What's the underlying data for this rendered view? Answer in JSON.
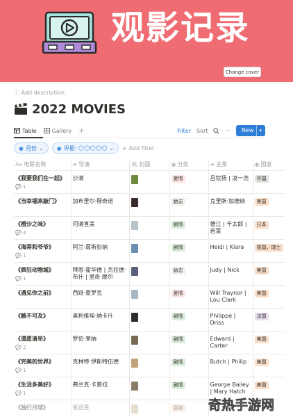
{
  "cover": {
    "title": "观影记录",
    "change_cover_label": "Change cover",
    "background_color": "#ee6c72",
    "logo_icon": "tv-play-icon"
  },
  "page": {
    "add_description": "Add description",
    "title_icon": "clapper-board-icon",
    "title": "2022 MOVIES"
  },
  "view_bar": {
    "tabs": [
      {
        "label": "Table",
        "icon": "table-icon",
        "active": true
      },
      {
        "label": "Gallery",
        "icon": "gallery-icon",
        "active": false
      }
    ],
    "add_view": "+",
    "filter_label": "Filter",
    "sort_label": "Sort",
    "new_label": "New",
    "accent_color": "#2e7dd7"
  },
  "filters": {
    "month_pill": "月份",
    "rating_pill": "评星: 🌕🌕🌕🌕🌕",
    "add_filter": "+ Add filter"
  },
  "table": {
    "columns": [
      {
        "label": "电影名称",
        "icon": "Aa"
      },
      {
        "label": "导演",
        "icon": "text-icon"
      },
      {
        "label": "封面",
        "icon": "paperclip-icon"
      },
      {
        "label": "分类",
        "icon": "select-icon"
      },
      {
        "label": "主角",
        "icon": "text-icon"
      },
      {
        "label": "国家",
        "icon": "select-icon"
      }
    ],
    "rows": [
      {
        "title": "《我要我们在一起》",
        "comments": "1",
        "director": "沙漠",
        "category": "爱情",
        "cast": "吕钦扬 | 凌一尧",
        "country": "中国",
        "poster": "#6f8a3d"
      },
      {
        "title": "《当幸福来敲门》",
        "comments": "",
        "director": "加布里尔·穆奇诺",
        "category": "励志",
        "cast": "克里斯·加德纳",
        "country": "美国",
        "poster": "#3a2a2a"
      },
      {
        "title": "《橙沙之味》",
        "comments": "4",
        "director": "河濑直美",
        "category": "剧情",
        "cast": "德江 | 千太郎 | 若菜",
        "country": "日本",
        "poster": "#b7c4c9"
      },
      {
        "title": "《海蒂和爷爷》",
        "comments": "1",
        "director": "阿兰·葛斯彭纳",
        "category": "剧情",
        "cast": "Heidi | Klara",
        "country": "德国，瑞士",
        "poster": "#6b8fb0"
      },
      {
        "title": "《疯狂动物城》",
        "comments": "1",
        "director": "拜恩·霍华德 | 杰拉德·布什 | 里奇·摩尔",
        "category": "励志",
        "cast": "Judy | Nick",
        "country": "美国",
        "poster": "#5a5f7a"
      },
      {
        "title": "《遇见你之前》",
        "comments": "",
        "director": "西娅·夏罗克",
        "category": "爱情",
        "cast": "Will Traynor | Lou Clark",
        "country": "美国",
        "poster": "#a7b8c4"
      },
      {
        "title": "《触不可及》",
        "comments": "",
        "director": "奥利维埃·纳卡什",
        "category": "剧情",
        "cast": "Philippe | Driss",
        "country": "法国",
        "poster": "#2d2d2d"
      },
      {
        "title": "《遗愿清单》",
        "comments": "2",
        "director": "罗伯·莱纳",
        "category": "剧情",
        "cast": "Edward | Carter",
        "country": "美国",
        "poster": "#7a6b55"
      },
      {
        "title": "《完美的世界》",
        "comments": "1",
        "director": "克林特·伊斯特伍德",
        "category": "剧情",
        "cast": "Butch | Philip",
        "country": "美国",
        "poster": "#c2a27a"
      },
      {
        "title": "《生活多美好》",
        "comments": "1",
        "director": "弗兰克·卡普拉",
        "category": "剧情",
        "cast": "George Bailey | Mary Hatch",
        "country": "美国",
        "poster": "#8c7d68"
      },
      {
        "title": "《独行月球》",
        "comments": "",
        "director": "张迟昱",
        "category": "喜剧",
        "cast": "",
        "country": "",
        "poster": "#c9b99a"
      }
    ],
    "tag_colors": {
      "爱情": "#fbe4e4",
      "励志": "#f1f1ef",
      "剧情": "#dbeddb",
      "喜剧": "#fadec9",
      "中国": "#e3e2e0",
      "美国": "#fadec9",
      "日本": "#fadec9",
      "德国，瑞士": "#fadec9",
      "法国": "#e8deee"
    }
  },
  "watermark": "奇热手游网"
}
